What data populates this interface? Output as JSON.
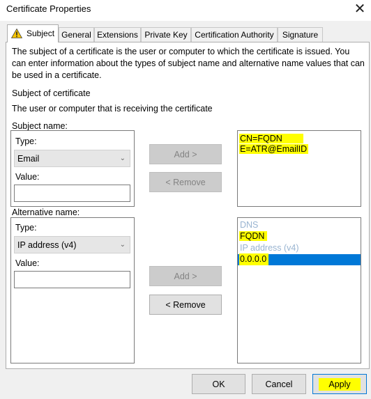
{
  "window": {
    "title": "Certificate Properties",
    "close_glyph": "✕"
  },
  "tabs": [
    {
      "label": "Subject"
    },
    {
      "label": "General"
    },
    {
      "label": "Extensions"
    },
    {
      "label": "Private Key"
    },
    {
      "label": "Certification Authority"
    },
    {
      "label": "Signature"
    }
  ],
  "intro": {
    "description": "The subject of a certificate is the user or computer to which the certificate is issued. You can enter information about the types of subject name and alternative name values that can be used in a certificate.",
    "section_title": "Subject of certificate",
    "section_subtitle": "The user or computer that is receiving the certificate"
  },
  "subject_name": {
    "label": "Subject name:",
    "type_label": "Type:",
    "type_value": "Email",
    "value_label": "Value:",
    "value_text": "",
    "add_label": "Add >",
    "remove_label": "< Remove",
    "list": [
      "CN=FQDN",
      "E=ATR@EmailID"
    ]
  },
  "alternative_name": {
    "label": "Alternative name:",
    "type_label": "Type:",
    "type_value": "IP address (v4)",
    "value_label": "Value:",
    "value_text": "",
    "add_label": "Add >",
    "remove_label": "< Remove",
    "list": {
      "dns_header": "DNS",
      "dns_value": "FQDN",
      "ip_header": "IP address (v4)",
      "ip_value": "0.0.0.0"
    }
  },
  "footer": {
    "ok_label": "OK",
    "cancel_label": "Cancel",
    "apply_label": "Apply"
  },
  "colors": {
    "highlight": "#ffff00",
    "selection": "#0078d7",
    "group_header": "#99b4d1"
  }
}
